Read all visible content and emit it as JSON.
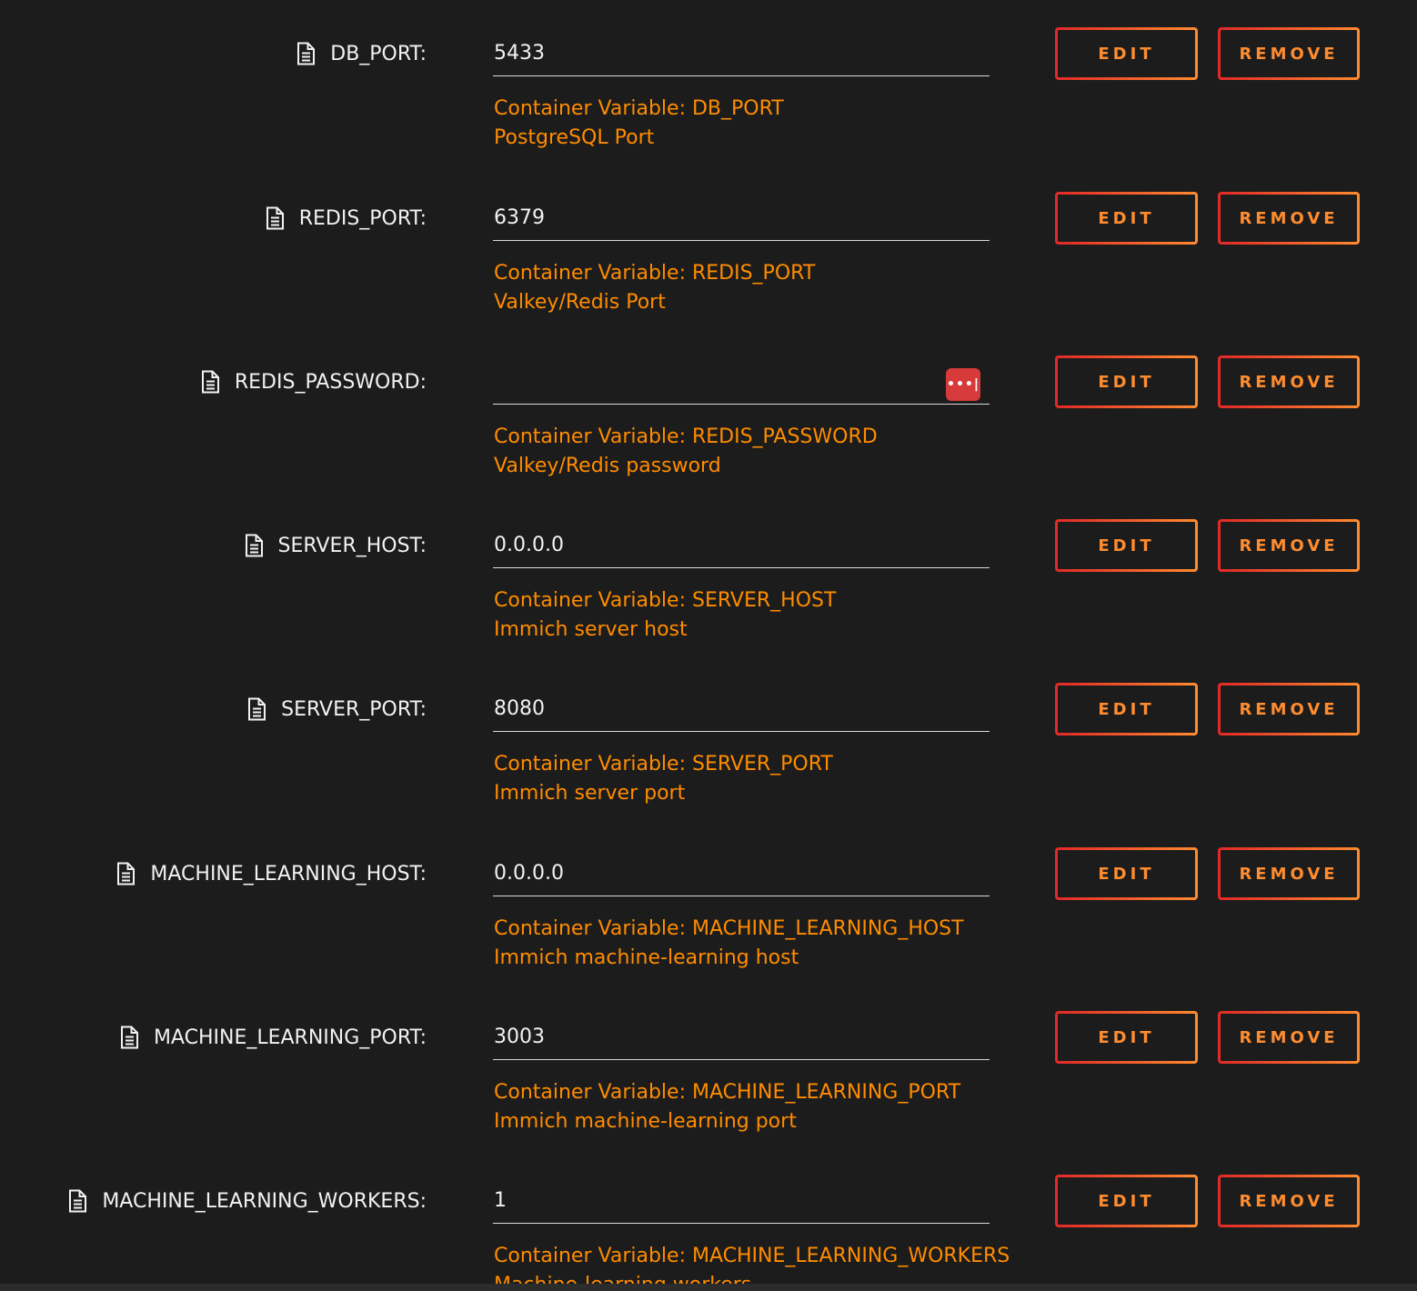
{
  "colors": {
    "background": "#1c1c1c",
    "label_text": "#f2f2f2",
    "help_text": "#ff8c00",
    "button_gradient_start": "#e22828",
    "button_gradient_end": "#ff8c2f",
    "password_manager_icon": "#d63a3a"
  },
  "icons": {
    "row_icon": "document-icon",
    "password_icon": "password-manager-icon"
  },
  "buttons": {
    "edit_label": "EDIT",
    "remove_label": "REMOVE"
  },
  "variables": [
    {
      "label": "DB_PORT:",
      "value": "5433",
      "container_variable": "Container Variable: DB_PORT",
      "description": "PostgreSQL Port"
    },
    {
      "label": "REDIS_PORT:",
      "value": "6379",
      "container_variable": "Container Variable: REDIS_PORT",
      "description": "Valkey/Redis Port"
    },
    {
      "label": "REDIS_PASSWORD:",
      "value": "",
      "container_variable": "Container Variable: REDIS_PASSWORD",
      "description": "Valkey/Redis password",
      "password_icon_text": "•••|"
    },
    {
      "label": "SERVER_HOST:",
      "value": "0.0.0.0",
      "container_variable": "Container Variable: SERVER_HOST",
      "description": "Immich server host"
    },
    {
      "label": "SERVER_PORT:",
      "value": "8080",
      "container_variable": "Container Variable: SERVER_PORT",
      "description": "Immich server port"
    },
    {
      "label": "MACHINE_LEARNING_HOST:",
      "value": "0.0.0.0",
      "container_variable": "Container Variable: MACHINE_LEARNING_HOST",
      "description": "Immich machine-learning host"
    },
    {
      "label": "MACHINE_LEARNING_PORT:",
      "value": "3003",
      "container_variable": "Container Variable: MACHINE_LEARNING_PORT",
      "description": "Immich machine-learning port"
    },
    {
      "label": "MACHINE_LEARNING_WORKERS:",
      "value": "1",
      "container_variable": "Container Variable: MACHINE_LEARNING_WORKERS",
      "description": "Machine-learning workers"
    }
  ]
}
